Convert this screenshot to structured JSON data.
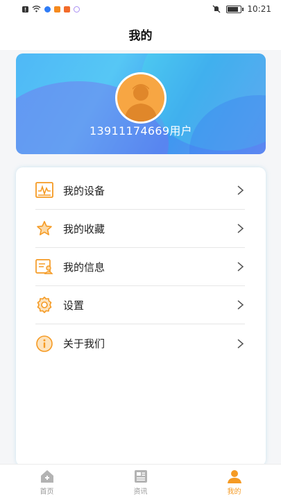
{
  "status_bar": {
    "time": "10:21",
    "battery_level": 0.85,
    "left_icons": [
      "alert-icon",
      "wifi-icon",
      "app-icon-blue",
      "app-icon-orange",
      "app-icon-bubble",
      "app-icon-ring"
    ],
    "right_icons": [
      "mute-icon",
      "battery-icon"
    ]
  },
  "header": {
    "title": "我的"
  },
  "profile": {
    "username": "13911174669用户",
    "avatar_icon": "user-avatar-icon",
    "colors": {
      "avatar_bg": "#f7a643",
      "card_gradient_start": "#4fb8f6",
      "card_gradient_end": "#6f8ff2"
    }
  },
  "menu": {
    "items": [
      {
        "label": "我的设备",
        "icon": "device-monitor-icon"
      },
      {
        "label": "我的收藏",
        "icon": "star-icon"
      },
      {
        "label": "我的信息",
        "icon": "id-card-icon"
      },
      {
        "label": "设置",
        "icon": "gear-icon"
      },
      {
        "label": "关于我们",
        "icon": "info-icon"
      }
    ],
    "accent_color": "#f59a23"
  },
  "tab_bar": {
    "tabs": [
      {
        "label": "首页",
        "icon": "home-icon",
        "active": false
      },
      {
        "label": "资讯",
        "icon": "news-icon",
        "active": false
      },
      {
        "label": "我的",
        "icon": "profile-icon",
        "active": true
      }
    ],
    "active_color": "#f59a23",
    "inactive_color": "#999999"
  }
}
